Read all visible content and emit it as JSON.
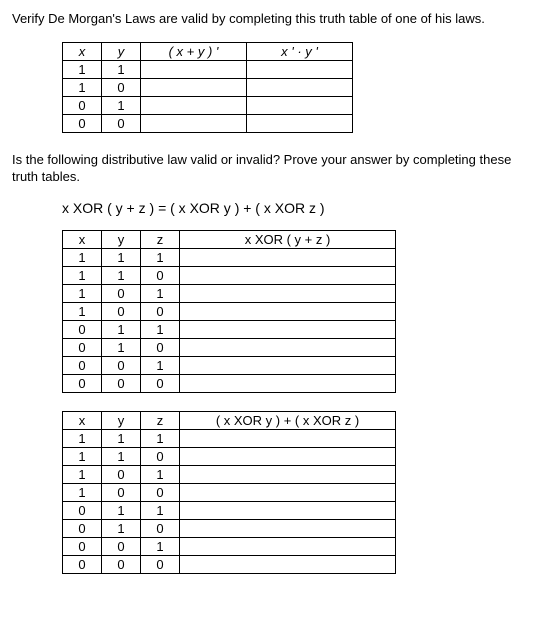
{
  "q1_instr": "Verify De Morgan's Laws are valid by completing this truth table of one of his laws.",
  "t1": {
    "h_x": "x",
    "h_y": "y",
    "h_c1": "( x + y ) '",
    "h_c2": "x '  ·  y '",
    "rows": [
      {
        "x": "1",
        "y": "1"
      },
      {
        "x": "1",
        "y": "0"
      },
      {
        "x": "0",
        "y": "1"
      },
      {
        "x": "0",
        "y": "0"
      }
    ]
  },
  "q2_instr": "Is the following distributive law valid or invalid?  Prove your answer by completing these truth tables.",
  "formula": "x XOR ( y + z ) = ( x XOR y ) + ( x XOR z )",
  "t2": {
    "h_x": "x",
    "h_y": "y",
    "h_z": "z",
    "h_r": "x XOR ( y + z )",
    "rows": [
      {
        "x": "1",
        "y": "1",
        "z": "1"
      },
      {
        "x": "1",
        "y": "1",
        "z": "0"
      },
      {
        "x": "1",
        "y": "0",
        "z": "1"
      },
      {
        "x": "1",
        "y": "0",
        "z": "0"
      },
      {
        "x": "0",
        "y": "1",
        "z": "1"
      },
      {
        "x": "0",
        "y": "1",
        "z": "0"
      },
      {
        "x": "0",
        "y": "0",
        "z": "1"
      },
      {
        "x": "0",
        "y": "0",
        "z": "0"
      }
    ]
  },
  "t3": {
    "h_x": "x",
    "h_y": "y",
    "h_z": "z",
    "h_r": "( x XOR y ) + ( x XOR z )",
    "rows": [
      {
        "x": "1",
        "y": "1",
        "z": "1"
      },
      {
        "x": "1",
        "y": "1",
        "z": "0"
      },
      {
        "x": "1",
        "y": "0",
        "z": "1"
      },
      {
        "x": "1",
        "y": "0",
        "z": "0"
      },
      {
        "x": "0",
        "y": "1",
        "z": "1"
      },
      {
        "x": "0",
        "y": "1",
        "z": "0"
      },
      {
        "x": "0",
        "y": "0",
        "z": "1"
      },
      {
        "x": "0",
        "y": "0",
        "z": "0"
      }
    ]
  }
}
